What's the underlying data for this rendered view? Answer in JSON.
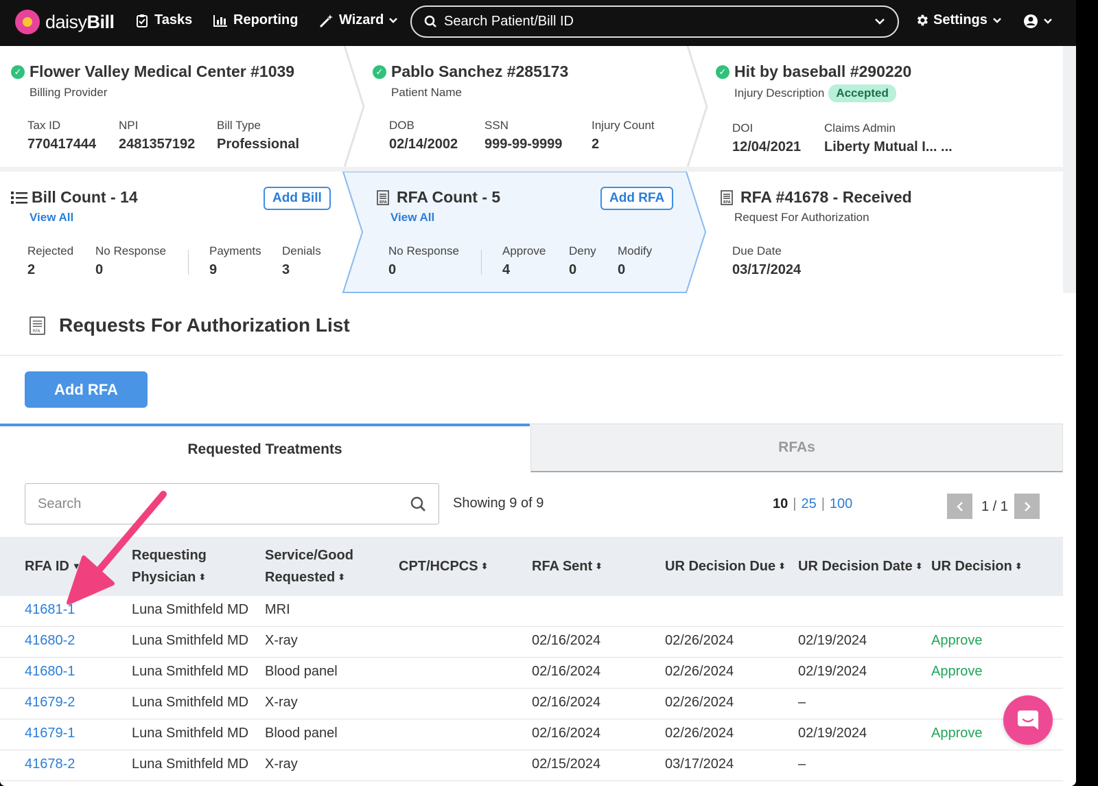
{
  "nav": {
    "logo_prefix": "daisy",
    "logo_suffix": "Bill",
    "tasks": "Tasks",
    "reporting": "Reporting",
    "wizard": "Wizard",
    "search_placeholder": "Search Patient/Bill ID",
    "settings": "Settings"
  },
  "provider": {
    "title": "Flower Valley Medical Center #1039",
    "subtitle": "Billing Provider",
    "tax_label": "Tax ID",
    "tax_value": "770417444",
    "npi_label": "NPI",
    "npi_value": "2481357192",
    "billtype_label": "Bill Type",
    "billtype_value": "Professional"
  },
  "patient": {
    "title": "Pablo Sanchez #285173",
    "subtitle": "Patient Name",
    "dob_label": "DOB",
    "dob_value": "02/14/2002",
    "ssn_label": "SSN",
    "ssn_value": "999-99-9999",
    "injury_label": "Injury Count",
    "injury_value": "2"
  },
  "injury": {
    "title": "Hit by baseball #290220",
    "subtitle": "Injury Description",
    "badge": "Accepted",
    "doi_label": "DOI",
    "doi_value": "12/04/2021",
    "claims_label": "Claims Admin",
    "claims_value": "Liberty Mutual I... ..."
  },
  "bills": {
    "title": "Bill Count - 14",
    "view_all": "View All",
    "add_button": "Add Bill",
    "rejected_label": "Rejected",
    "rejected_value": "2",
    "noresp_label": "No Response",
    "noresp_value": "0",
    "payments_label": "Payments",
    "payments_value": "9",
    "denials_label": "Denials",
    "denials_value": "3"
  },
  "rfas": {
    "title": "RFA Count - 5",
    "view_all": "View All",
    "add_button": "Add RFA",
    "noresp_label": "No Response",
    "noresp_value": "0",
    "approve_label": "Approve",
    "approve_value": "4",
    "deny_label": "Deny",
    "deny_value": "0",
    "modify_label": "Modify",
    "modify_value": "0"
  },
  "rfa_detail": {
    "title": "RFA #41678 - Received",
    "subtitle": "Request For Authorization",
    "due_label": "Due Date",
    "due_value": "03/17/2024"
  },
  "section": {
    "title": "Requests For Authorization List",
    "add_button": "Add RFA",
    "tab_active": "Requested Treatments",
    "tab_inactive": "RFAs",
    "search_placeholder": "Search",
    "showing": "Showing 9 of 9",
    "page_sizes": [
      "10",
      "25",
      "100"
    ],
    "page_info": "1 / 1"
  },
  "table": {
    "headers": {
      "rfa_id": "RFA ID",
      "physician_1": "Requesting",
      "physician_2": "Physician",
      "service_1": "Service/Good",
      "service_2": "Requested",
      "cpt": "CPT/HCPCS",
      "sent": "RFA Sent",
      "due": "UR Decision Due",
      "date": "UR Decision Date",
      "decision": "UR Decision"
    },
    "rows": [
      {
        "id": "41681-1",
        "physician": "Luna Smithfeld MD",
        "service": "MRI",
        "cpt": "",
        "sent": "",
        "due": "",
        "date": "",
        "decision": ""
      },
      {
        "id": "41680-2",
        "physician": "Luna Smithfeld MD",
        "service": "X-ray",
        "cpt": "",
        "sent": "02/16/2024",
        "due": "02/26/2024",
        "date": "02/19/2024",
        "decision": "Approve"
      },
      {
        "id": "41680-1",
        "physician": "Luna Smithfeld MD",
        "service": "Blood panel",
        "cpt": "",
        "sent": "02/16/2024",
        "due": "02/26/2024",
        "date": "02/19/2024",
        "decision": "Approve"
      },
      {
        "id": "41679-2",
        "physician": "Luna Smithfeld MD",
        "service": "X-ray",
        "cpt": "",
        "sent": "02/16/2024",
        "due": "02/26/2024",
        "date": "–",
        "decision": ""
      },
      {
        "id": "41679-1",
        "physician": "Luna Smithfeld MD",
        "service": "Blood panel",
        "cpt": "",
        "sent": "02/16/2024",
        "due": "02/26/2024",
        "date": "02/19/2024",
        "decision": "Approve"
      },
      {
        "id": "41678-2",
        "physician": "Luna Smithfeld MD",
        "service": "X-ray",
        "cpt": "",
        "sent": "02/15/2024",
        "due": "03/17/2024",
        "date": "–",
        "decision": ""
      }
    ]
  },
  "colors": {
    "accent": "#4a94e6",
    "link": "#2a7ed8",
    "success": "#1ea55a",
    "badge_bg": "#b9f0da",
    "chat": "#ee4a94",
    "arrow": "#f0417e"
  }
}
